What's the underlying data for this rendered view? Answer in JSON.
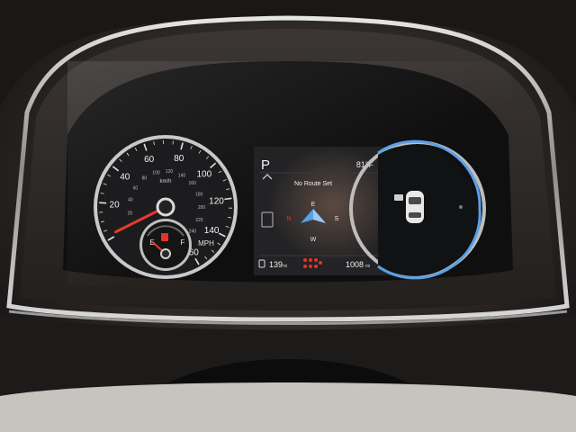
{
  "speedometer": {
    "mph_ticks": [
      "20",
      "40",
      "60",
      "80",
      "100",
      "120",
      "140",
      "160"
    ],
    "kmh_ticks": [
      "20",
      "40",
      "60",
      "80",
      "100",
      "120",
      "140",
      "160",
      "180",
      "200",
      "220",
      "240",
      "260"
    ],
    "kmh_unit": "km/h",
    "mph_unit": "MPH",
    "speed_mph": 0
  },
  "fuel_gauge": {
    "empty_label": "E",
    "full_label": "F",
    "level": 0.1
  },
  "center_display": {
    "gear": "P",
    "temperature": "81°F",
    "route_status": "No Route Set",
    "compass": {
      "north": "E",
      "east": "S",
      "south": "W",
      "west": "N",
      "heading": "E"
    },
    "fuel_range": "139",
    "fuel_range_unit": "mi",
    "odometer": "1008",
    "odometer_unit": "mi"
  },
  "colors": {
    "accent_blue": "#5aa0e6",
    "needle_red": "#e33b2f",
    "gauge_face": "#1c1c1e",
    "warning_red": "#e5322a"
  }
}
